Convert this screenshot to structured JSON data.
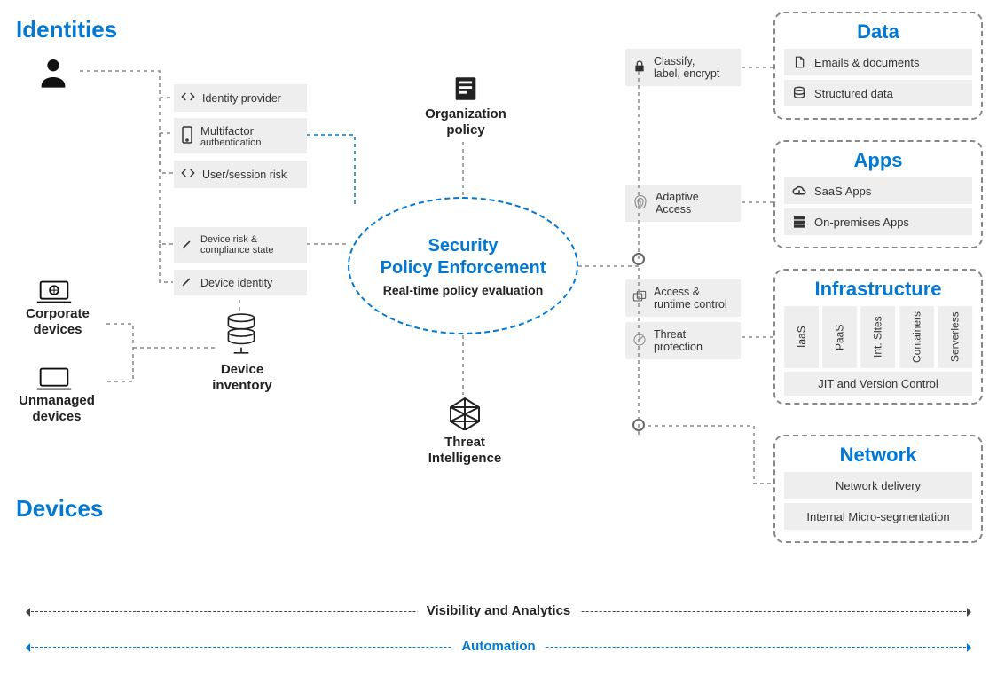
{
  "sections": {
    "identities": "Identities",
    "devices": "Devices"
  },
  "identity_items": {
    "provider": "Identity  provider",
    "mfa_t1": "Multifactor",
    "mfa_t2": "authentication",
    "risk": "User/session risk"
  },
  "device_items": {
    "risk_t1": "Device  risk &",
    "risk_t2": "compliance  state",
    "identity": "Device  identity",
    "inventory": "Device inventory",
    "corp_t1": "Corporate",
    "corp_t2": "devices",
    "unm_t1": "Unmanaged",
    "unm_t2": "devices"
  },
  "center": {
    "title_l1": "Security",
    "title_l2": "Policy  Enforcement",
    "sub": "Real-time policy evaluation"
  },
  "top_mid": {
    "org_policy_l1": "Organization",
    "org_policy_l2": "policy",
    "threat_intel_l1": "Threat",
    "threat_intel_l2": "Intelligence"
  },
  "mid_right": {
    "classify_l1": "Classify,",
    "classify_l2": "label, encrypt",
    "adaptive_l1": "Adaptive",
    "adaptive_l2": "Access",
    "access_l1": "Access &",
    "access_l2": "runtime control",
    "threat_l1": "Threat",
    "threat_l2": "protection"
  },
  "panels": {
    "data": {
      "title": "Data",
      "items": [
        "Emails & documents",
        "Structured data"
      ]
    },
    "apps": {
      "title": "Apps",
      "items": [
        "SaaS Apps",
        "On-premises Apps"
      ]
    },
    "infra": {
      "title": "Infrastructure",
      "cols": [
        "IaaS",
        "PaaS",
        "Int. Sites",
        "Containers",
        "Serverless"
      ],
      "wide": "JIT and Version Control"
    },
    "network": {
      "title": "Network",
      "items": [
        "Network delivery",
        "Internal Micro-segmentation"
      ]
    }
  },
  "footer": {
    "visibility": "Visibility and Analytics",
    "automation": "Automation"
  }
}
